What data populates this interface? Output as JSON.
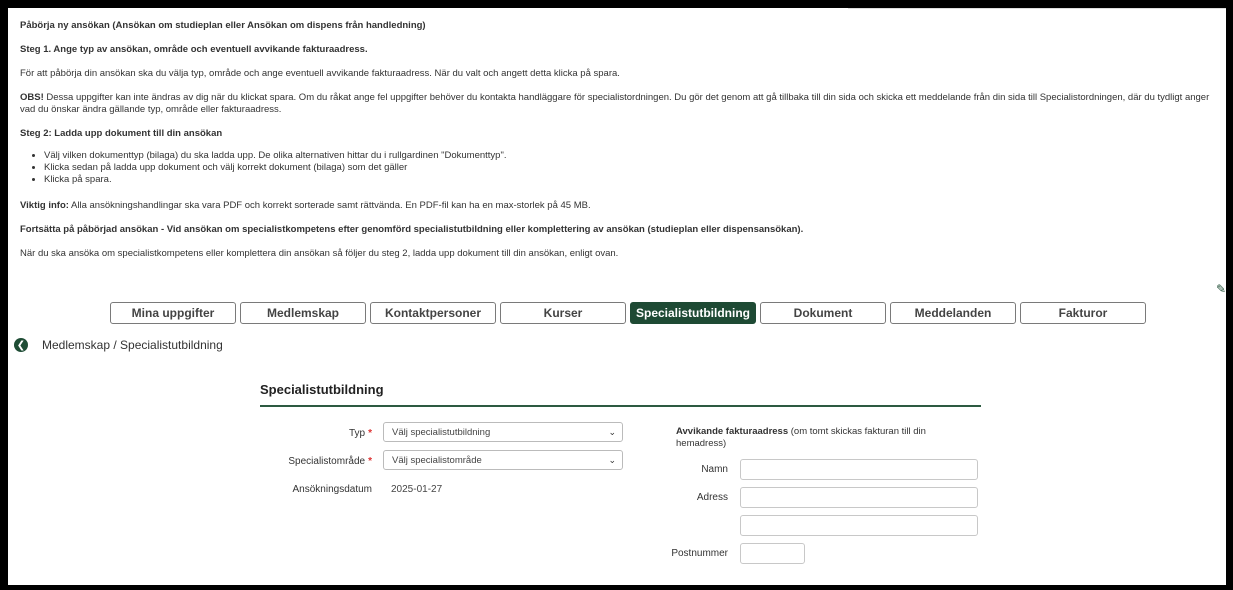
{
  "info": {
    "heading": "Påbörja ny ansökan (Ansökan om studieplan eller Ansökan om dispens från handledning)",
    "step1_title": "Steg 1. Ange typ av ansökan, område och eventuell avvikande fakturaadress.",
    "step1_text": "För att påbörja din ansökan ska du välja typ, område och ange eventuell avvikande fakturaadress. När du valt och angett detta klicka på spara.",
    "obs_label": "OBS!",
    "obs_text": " Dessa uppgifter kan inte ändras av dig när du klickat spara. Om du råkat ange fel uppgifter behöver du kontakta handläggare för specialistordningen. Du gör det genom att gå tillbaka till din sida och skicka ett meddelande från din sida till Specialistordningen, där du tydligt anger vad du önskar ändra gällande typ, område eller fakturaadress.",
    "step2_title": "Steg 2: Ladda upp dokument till din ansökan",
    "bullets": [
      "Välj vilken dokumenttyp (bilaga) du ska ladda upp. De olika alternativen hittar du i rullgardinen \"Dokumenttyp\".",
      "Klicka sedan på ladda upp dokument och välj korrekt dokument (bilaga) som det gäller",
      "Klicka på spara."
    ],
    "important_label": "Viktig info:",
    "important_text": " Alla ansökningshandlingar ska vara PDF och korrekt sorterade samt rättvända. En PDF-fil kan ha en max-storlek på 45 MB.",
    "continue_title": "Fortsätta på påbörjad ansökan - Vid ansökan om specialistkompetens efter genomförd specialistutbildning eller komplettering av ansökan (studieplan eller dispensansökan).",
    "continue_text": "När du ska ansöka om specialistkompetens eller komplettera din ansökan så följer du steg 2, ladda upp dokument till din ansökan, enligt ovan."
  },
  "tabs": [
    {
      "label": "Mina uppgifter"
    },
    {
      "label": "Medlemskap"
    },
    {
      "label": "Kontaktpersoner"
    },
    {
      "label": "Kurser"
    },
    {
      "label": "Specialistutbildning",
      "active": true
    },
    {
      "label": "Dokument"
    },
    {
      "label": "Meddelanden"
    },
    {
      "label": "Fakturor"
    }
  ],
  "breadcrumb": {
    "text": "Medlemskap  / Specialistutbildning",
    "icon": "arrow-left-circle-icon"
  },
  "form": {
    "title": "Specialistutbildning",
    "typ_label": "Typ",
    "typ_value": "Välj specialistutbildning",
    "omrade_label": "Specialistområde",
    "omrade_value": "Välj specialistområde",
    "datum_label": "Ansökningsdatum",
    "datum_value": "2025-01-27",
    "alt_title_bold": "Avvikande fakturaadress",
    "alt_title_rest": " (om tomt skickas fakturan till din hemadress)",
    "namn_label": "Namn",
    "adress_label": "Adress",
    "postnummer_label": "Postnummer"
  },
  "colors": {
    "accent": "#1e4a34",
    "required": "#dd3333"
  }
}
